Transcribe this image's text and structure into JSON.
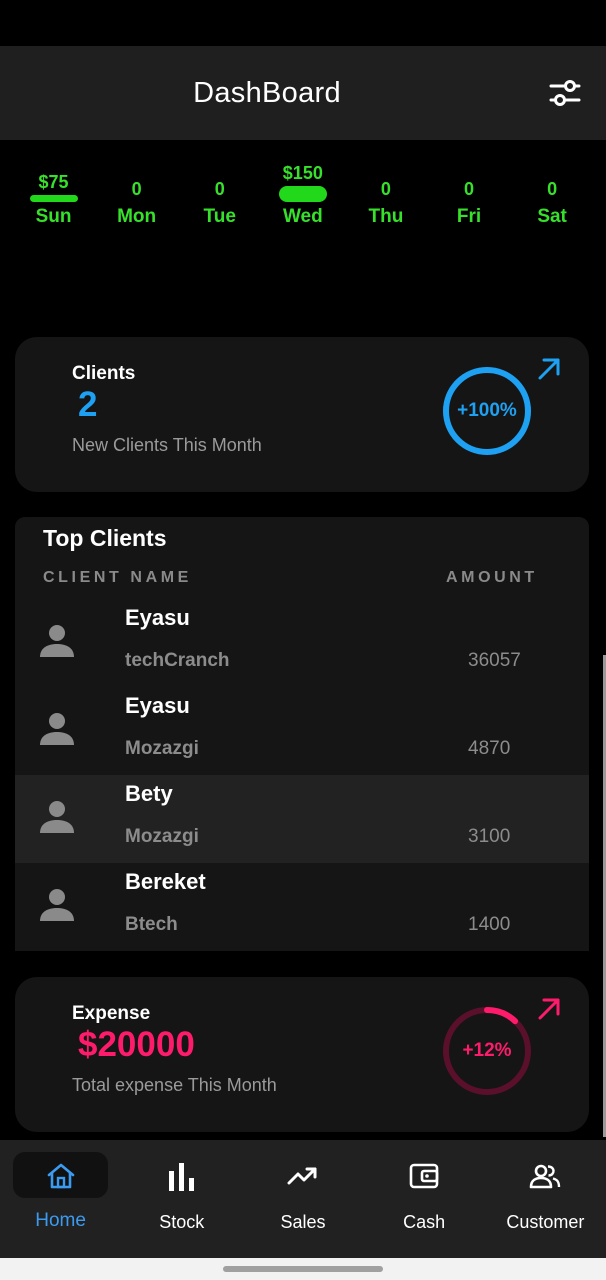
{
  "app_bar": {
    "title": "DashBoard",
    "filter_icon": "tune-icon"
  },
  "week": [
    {
      "amount": "$75",
      "day": "Sun",
      "bar": "small"
    },
    {
      "amount": "0",
      "day": "Mon",
      "bar": "none"
    },
    {
      "amount": "0",
      "day": "Tue",
      "bar": "none"
    },
    {
      "amount": "$150",
      "day": "Wed",
      "bar": "large"
    },
    {
      "amount": "0",
      "day": "Thu",
      "bar": "none"
    },
    {
      "amount": "0",
      "day": "Fri",
      "bar": "none"
    },
    {
      "amount": "0",
      "day": "Sat",
      "bar": "none"
    }
  ],
  "clients_card": {
    "label": "Clients",
    "value": "2",
    "subtitle": "New Clients This Month",
    "percent": "+100%",
    "ring_fill": 1.0,
    "color": "#1ea1f2"
  },
  "top_clients": {
    "title": "Top Clients",
    "col_name": "CLIENT NAME",
    "col_amount": "AMOUNT",
    "rows": [
      {
        "name": "Eyasu",
        "company": "techCranch",
        "amount": "36057"
      },
      {
        "name": "Eyasu",
        "company": "Mozazgi",
        "amount": "4870"
      },
      {
        "name": "Bety",
        "company": "Mozazgi",
        "amount": "3100"
      },
      {
        "name": "Bereket",
        "company": "Btech",
        "amount": "1400"
      }
    ]
  },
  "expense_card": {
    "label": "Expense",
    "value": "$20000",
    "subtitle": "Total expense This Month",
    "percent": "+12%",
    "ring_fill": 0.12,
    "color": "#ff1b6b"
  },
  "bottom_nav": [
    {
      "label": "Home",
      "icon": "home-icon",
      "active": true
    },
    {
      "label": "Stock",
      "icon": "bar-chart-icon",
      "active": false
    },
    {
      "label": "Sales",
      "icon": "trending-up-icon",
      "active": false
    },
    {
      "label": "Cash",
      "icon": "wallet-icon",
      "active": false
    },
    {
      "label": "Customer",
      "icon": "people-icon",
      "active": false
    }
  ]
}
